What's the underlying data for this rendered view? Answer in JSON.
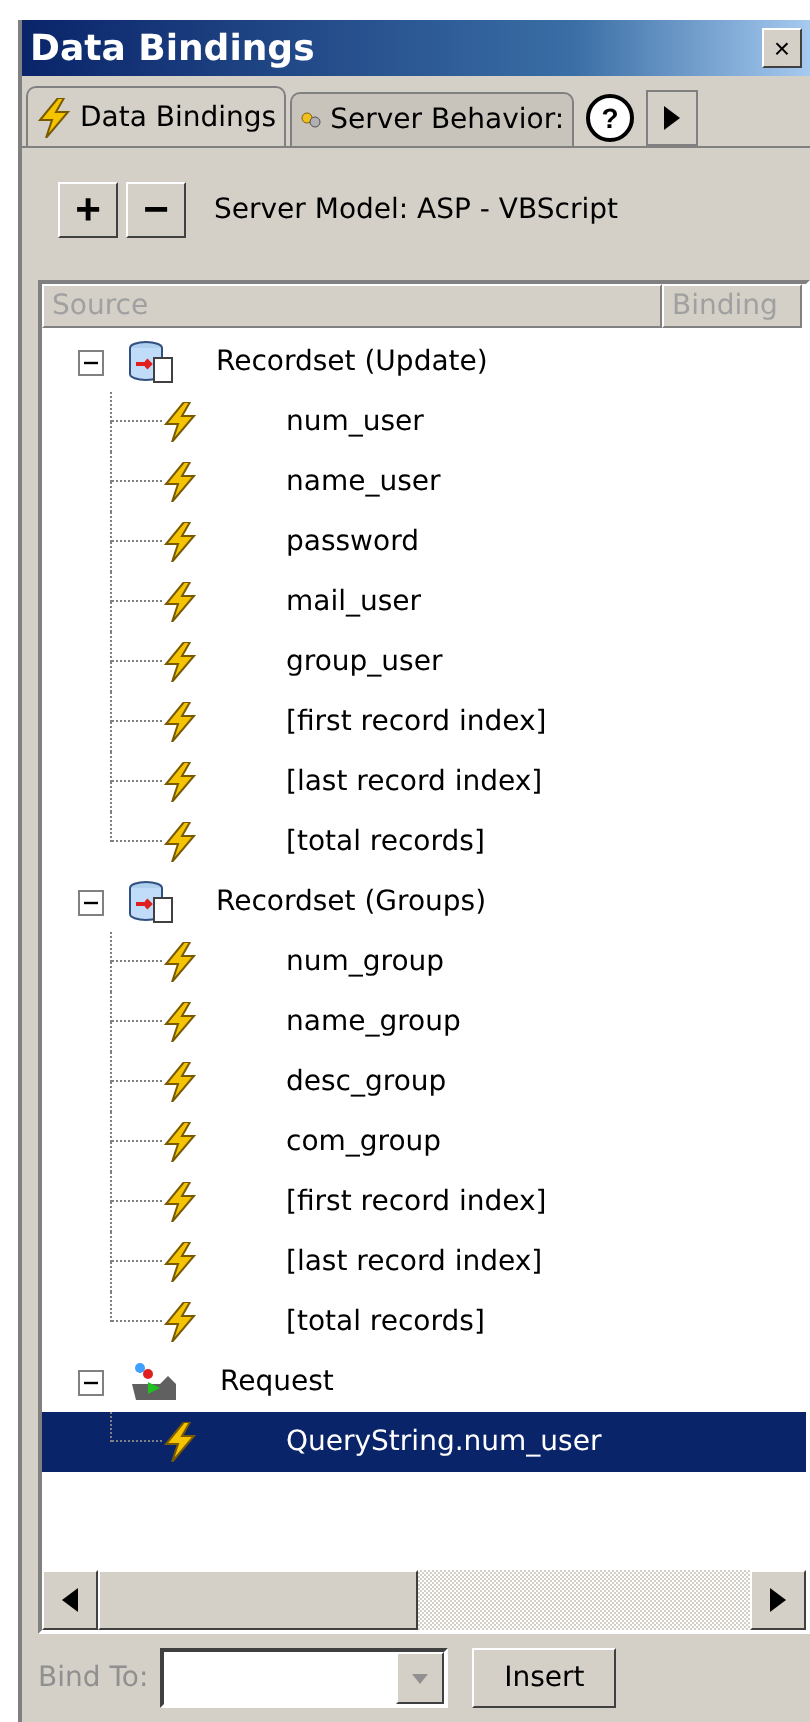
{
  "window": {
    "title": "Data Bindings",
    "close": "×"
  },
  "tabs": [
    {
      "label": "Data Bindings",
      "selected": true
    },
    {
      "label": "Server Behavior:",
      "selected": false
    }
  ],
  "help": "?",
  "toolbar": {
    "add": "+",
    "remove": "−",
    "server_model": "Server Model: ASP - VBScript"
  },
  "columns": [
    "Source",
    "Binding"
  ],
  "tree": [
    {
      "label": "Recordset (Update)",
      "kind": "recordset",
      "expanded": true,
      "selected": false,
      "children": [
        {
          "label": "num_user",
          "selected": false
        },
        {
          "label": "name_user",
          "selected": false
        },
        {
          "label": "password",
          "selected": false
        },
        {
          "label": "mail_user",
          "selected": false
        },
        {
          "label": "group_user",
          "selected": false
        },
        {
          "label": "[first record index]",
          "selected": false
        },
        {
          "label": "[last record index]",
          "selected": false
        },
        {
          "label": "[total records]",
          "selected": false
        }
      ]
    },
    {
      "label": "Recordset (Groups)",
      "kind": "recordset",
      "expanded": true,
      "selected": false,
      "children": [
        {
          "label": "num_group",
          "selected": false
        },
        {
          "label": "name_group",
          "selected": false
        },
        {
          "label": "desc_group",
          "selected": false
        },
        {
          "label": "com_group",
          "selected": false
        },
        {
          "label": "[first record index]",
          "selected": false
        },
        {
          "label": "[last record index]",
          "selected": false
        },
        {
          "label": "[total records]",
          "selected": false
        }
      ]
    },
    {
      "label": "Request",
      "kind": "request",
      "expanded": true,
      "selected": false,
      "children": [
        {
          "label": "QueryString.num_user",
          "selected": true
        }
      ]
    }
  ],
  "bind_to": {
    "label": "Bind To:",
    "disabled": true
  },
  "insert": "Insert"
}
